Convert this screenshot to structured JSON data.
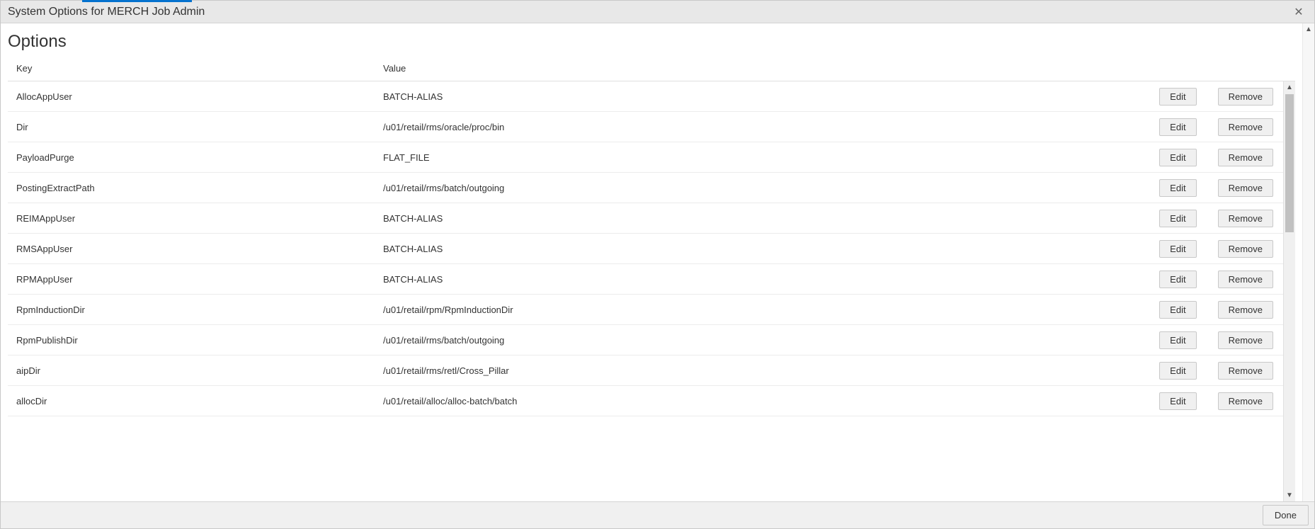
{
  "window": {
    "title": "System Options for MERCH Job Admin"
  },
  "page": {
    "heading": "Options"
  },
  "table": {
    "columns": {
      "key": "Key",
      "value": "Value"
    },
    "actions": {
      "edit": "Edit",
      "remove": "Remove"
    },
    "rows": [
      {
        "key": "AllocAppUser",
        "value": "BATCH-ALIAS"
      },
      {
        "key": "Dir",
        "value": "/u01/retail/rms/oracle/proc/bin"
      },
      {
        "key": "PayloadPurge",
        "value": "FLAT_FILE"
      },
      {
        "key": "PostingExtractPath",
        "value": "/u01/retail/rms/batch/outgoing"
      },
      {
        "key": "REIMAppUser",
        "value": "BATCH-ALIAS"
      },
      {
        "key": "RMSAppUser",
        "value": "BATCH-ALIAS"
      },
      {
        "key": "RPMAppUser",
        "value": "BATCH-ALIAS"
      },
      {
        "key": "RpmInductionDir",
        "value": "/u01/retail/rpm/RpmInductionDir"
      },
      {
        "key": "RpmPublishDir",
        "value": "/u01/retail/rms/batch/outgoing"
      },
      {
        "key": "aipDir",
        "value": "/u01/retail/rms/retl/Cross_Pillar"
      },
      {
        "key": "allocDir",
        "value": "/u01/retail/alloc/alloc-batch/batch"
      }
    ]
  },
  "footer": {
    "done": "Done"
  }
}
